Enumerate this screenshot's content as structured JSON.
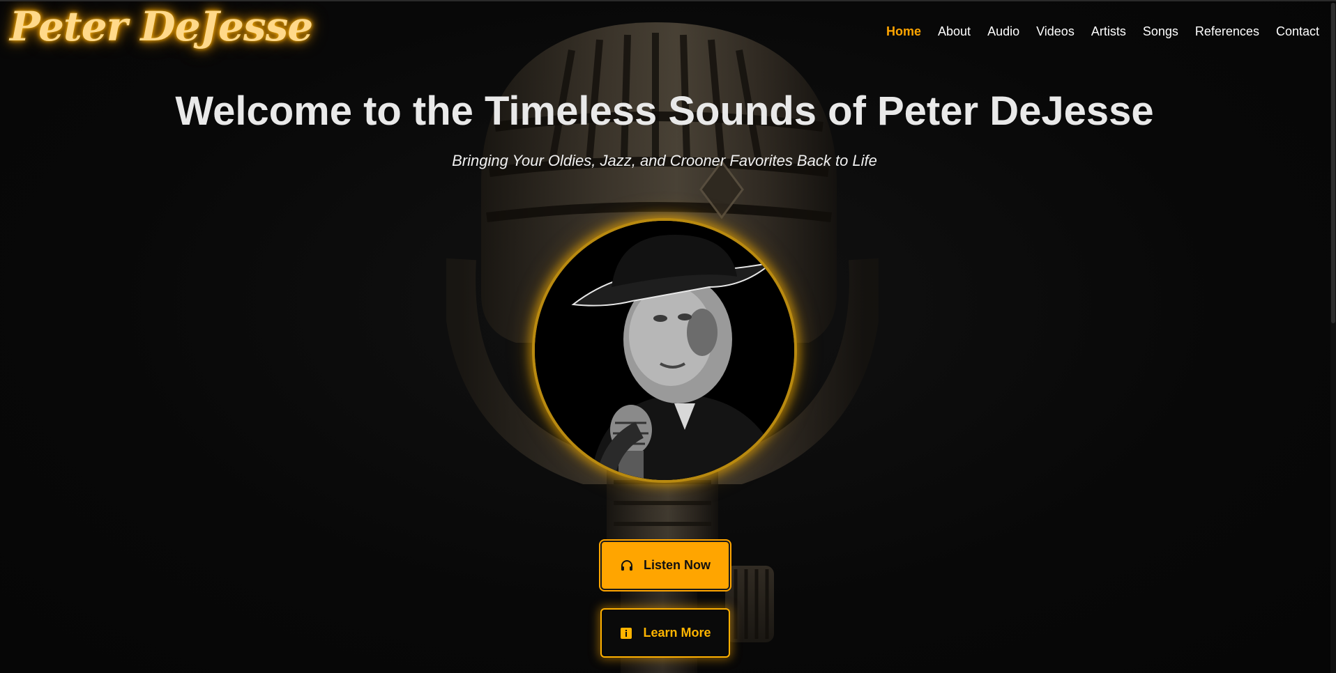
{
  "header": {
    "logo_text": "Peter DeJesse",
    "nav": [
      {
        "label": "Home",
        "active": true
      },
      {
        "label": "About",
        "active": false
      },
      {
        "label": "Audio",
        "active": false
      },
      {
        "label": "Videos",
        "active": false
      },
      {
        "label": "Artists",
        "active": false
      },
      {
        "label": "Songs",
        "active": false
      },
      {
        "label": "References",
        "active": false
      },
      {
        "label": "Contact",
        "active": false
      }
    ]
  },
  "hero": {
    "title": "Welcome to the Timeless Sounds of Peter DeJesse",
    "subtitle": "Bringing Your Oldies, Jazz, and Crooner Favorites Back to Life",
    "listen_button": {
      "label": "Listen Now",
      "icon": "headphones-icon"
    },
    "learn_button": {
      "label": "Learn More",
      "icon": "info-icon"
    }
  },
  "colors": {
    "accent": "#ffa500",
    "logo_glow": "#ffd98a",
    "background": "#080808"
  }
}
